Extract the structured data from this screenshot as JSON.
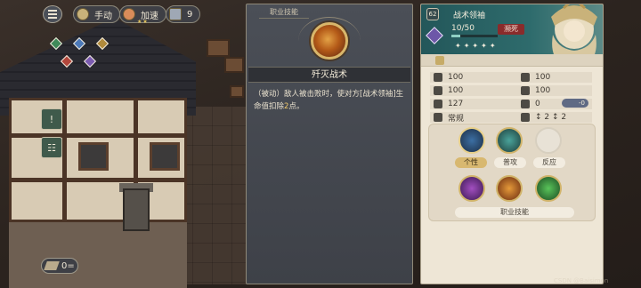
{
  "topbar": {
    "mode_label": "手动",
    "speed_label": "加速",
    "turn_count": "9"
  },
  "bottom": {
    "tile_count": "0="
  },
  "skill_panel": {
    "header": "职业技能",
    "name": "歼灭战术",
    "desc_prefix": "（被动）敌人被击败时，使对方[战术领袖]生命值扣除",
    "desc_value": "2",
    "desc_suffix": "点。"
  },
  "character": {
    "level_badge": "62",
    "title": "战术领袖",
    "hp": "10/50",
    "hp_fraction": 0.2,
    "status_tag": "濒死",
    "stars": "✦✦✦✦✦",
    "stats": {
      "s1": "100",
      "s2": "100",
      "s3": "100",
      "s4": "100",
      "s5": "127",
      "s6": "0",
      "s6_delta": "-0",
      "s7": "常规",
      "s8": "↕ 2  ↕ 2"
    },
    "skills": {
      "personal": "个性",
      "attack": "普攻",
      "reaction": "反应",
      "job": "职业技能"
    }
  },
  "colors": {
    "header_teal": "#2e6b6c",
    "status_red": "#8a2b2b",
    "panel_cream": "#eee6d6",
    "accent_gold": "#d1b46a"
  },
  "watermark": "CSDN @Baisimon"
}
